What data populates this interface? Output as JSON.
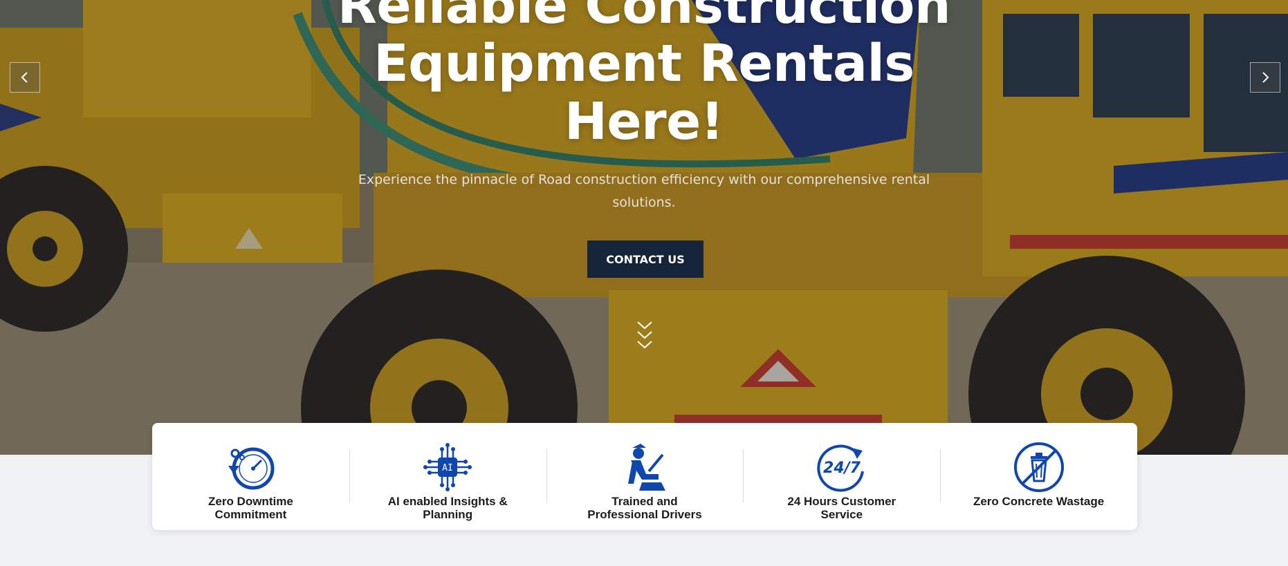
{
  "hero": {
    "title": "Reliable Construction Equipment Rentals Here!",
    "subtitle": "Experience the pinnacle of Road construction efficiency with our comprehensive rental solutions.",
    "cta_label": "CONTACT US",
    "overlay_color": "#14161e",
    "cta_color": "#16243a"
  },
  "slider": {
    "prev_icon": "chevron-left-icon",
    "next_icon": "chevron-right-icon"
  },
  "scroll_icon": "triple-chevron-down-icon",
  "accent_color": "#0f47af",
  "features": [
    {
      "label": "Zero Downtime Commitment",
      "icon": "speedometer-gear-icon"
    },
    {
      "label": "AI enabled Insights & Planning",
      "icon": "ai-chip-icon"
    },
    {
      "label": "Trained and Professional Drivers",
      "icon": "driver-icon"
    },
    {
      "label": "24 Hours Customer Service",
      "icon": "clock-24-7-icon"
    },
    {
      "label": "Zero Concrete Wastage",
      "icon": "no-waste-bin-icon"
    }
  ]
}
